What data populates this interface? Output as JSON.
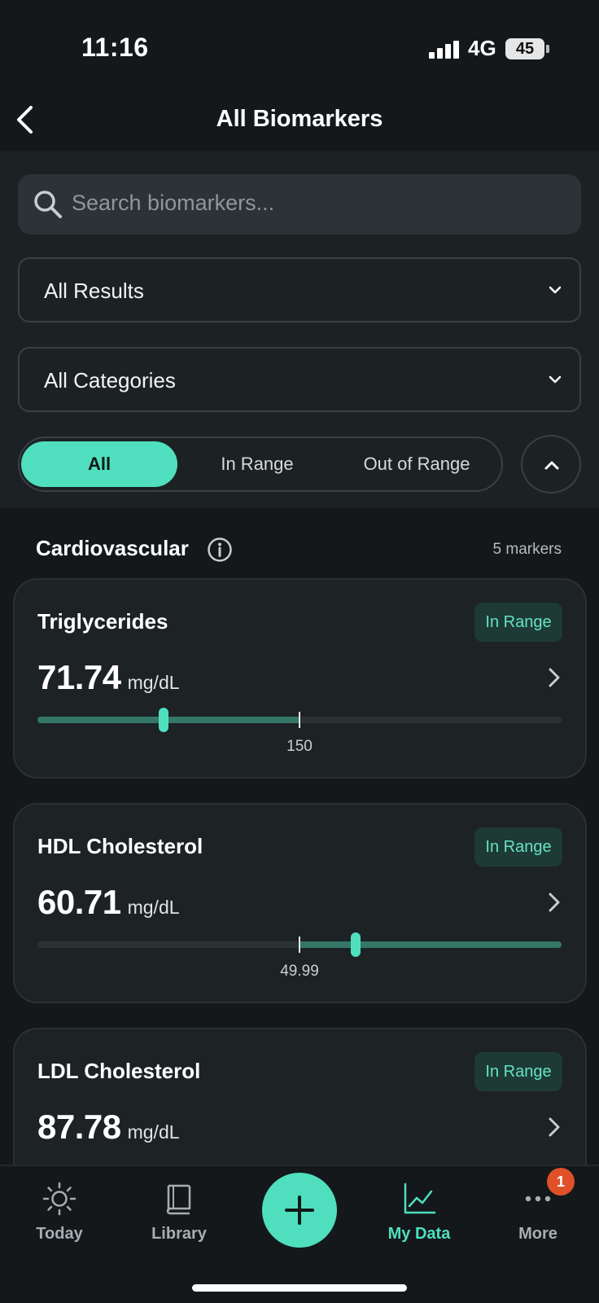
{
  "status_bar": {
    "time": "11:16",
    "network": "4G",
    "battery": "45"
  },
  "header": {
    "title": "All Biomarkers"
  },
  "search": {
    "placeholder": "Search biomarkers..."
  },
  "filters": {
    "results_selected": "All Results",
    "categories_selected": "All Categories"
  },
  "segments": [
    {
      "label": "All",
      "active": true
    },
    {
      "label": "In Range",
      "active": false
    },
    {
      "label": "Out of Range",
      "active": false
    }
  ],
  "section": {
    "title": "Cardiovascular",
    "count": "5 markers"
  },
  "cards": [
    {
      "name": "Triglycerides",
      "status": "In Range",
      "value": "71.74",
      "unit": "mg/dL",
      "ref_label": "150",
      "value_fraction": 0.24,
      "ref_fraction": 0.5,
      "in_range_side": "below"
    },
    {
      "name": "HDL Cholesterol",
      "status": "In Range",
      "value": "60.71",
      "unit": "mg/dL",
      "ref_label": "49.99",
      "value_fraction": 0.607,
      "ref_fraction": 0.5,
      "in_range_side": "above"
    },
    {
      "name": "LDL Cholesterol",
      "status": "In Range",
      "value": "87.78",
      "unit": "mg/dL"
    }
  ],
  "nav": {
    "today": "Today",
    "library": "Library",
    "my_data": "My Data",
    "more": "More",
    "more_badge": "1",
    "active": "my_data"
  },
  "colors": {
    "accent": "#4fdfbe",
    "in_range_fill": "#347767",
    "badge_bg": "#1e3a34",
    "notification": "#e0512a"
  },
  "icons": [
    "back-arrow-icon",
    "search-icon",
    "chevron-down-icon",
    "chevron-up-icon",
    "info-icon",
    "chevron-right-icon",
    "sun-icon",
    "book-icon",
    "plus-icon",
    "chart-line-icon",
    "more-dots-icon"
  ]
}
